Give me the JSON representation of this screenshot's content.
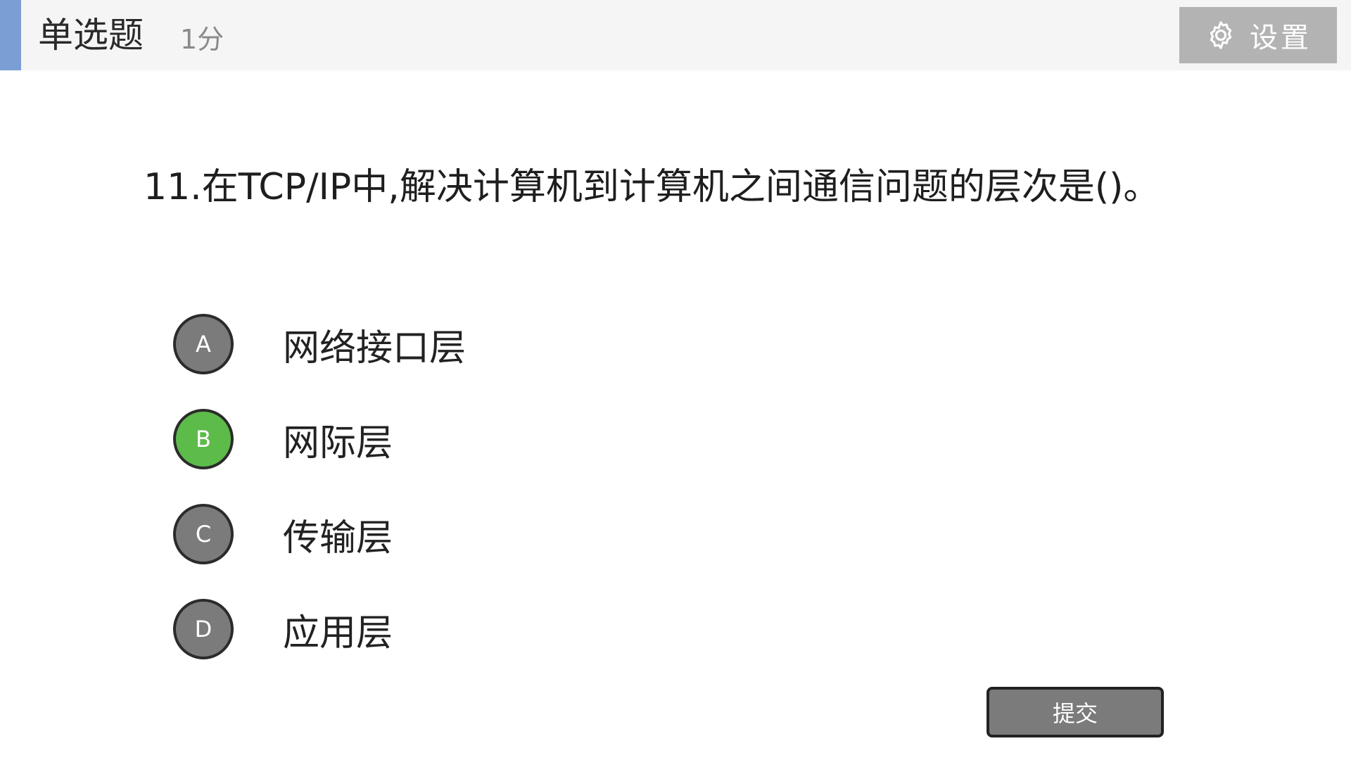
{
  "header": {
    "question_type": "单选题",
    "score": "1分",
    "settings_label": "设置",
    "settings_icon": "gear-icon",
    "accent_color": "#7b9fd4",
    "settings_bg": "#b3b3b3"
  },
  "question": {
    "text": "11.在TCP/IP中,解决计算机到计算机之间通信问题的层次是()。"
  },
  "options": [
    {
      "letter": "A",
      "text": "网络接口层",
      "color": "#7b7b7b",
      "selected": false
    },
    {
      "letter": "B",
      "text": "网际层",
      "color": "#5dbb4a",
      "selected": true
    },
    {
      "letter": "C",
      "text": "传输层",
      "color": "#7b7b7b",
      "selected": false
    },
    {
      "letter": "D",
      "text": "应用层",
      "color": "#7b7b7b",
      "selected": false
    }
  ],
  "submit": {
    "label": "提交",
    "bg": "#7b7b7b"
  }
}
